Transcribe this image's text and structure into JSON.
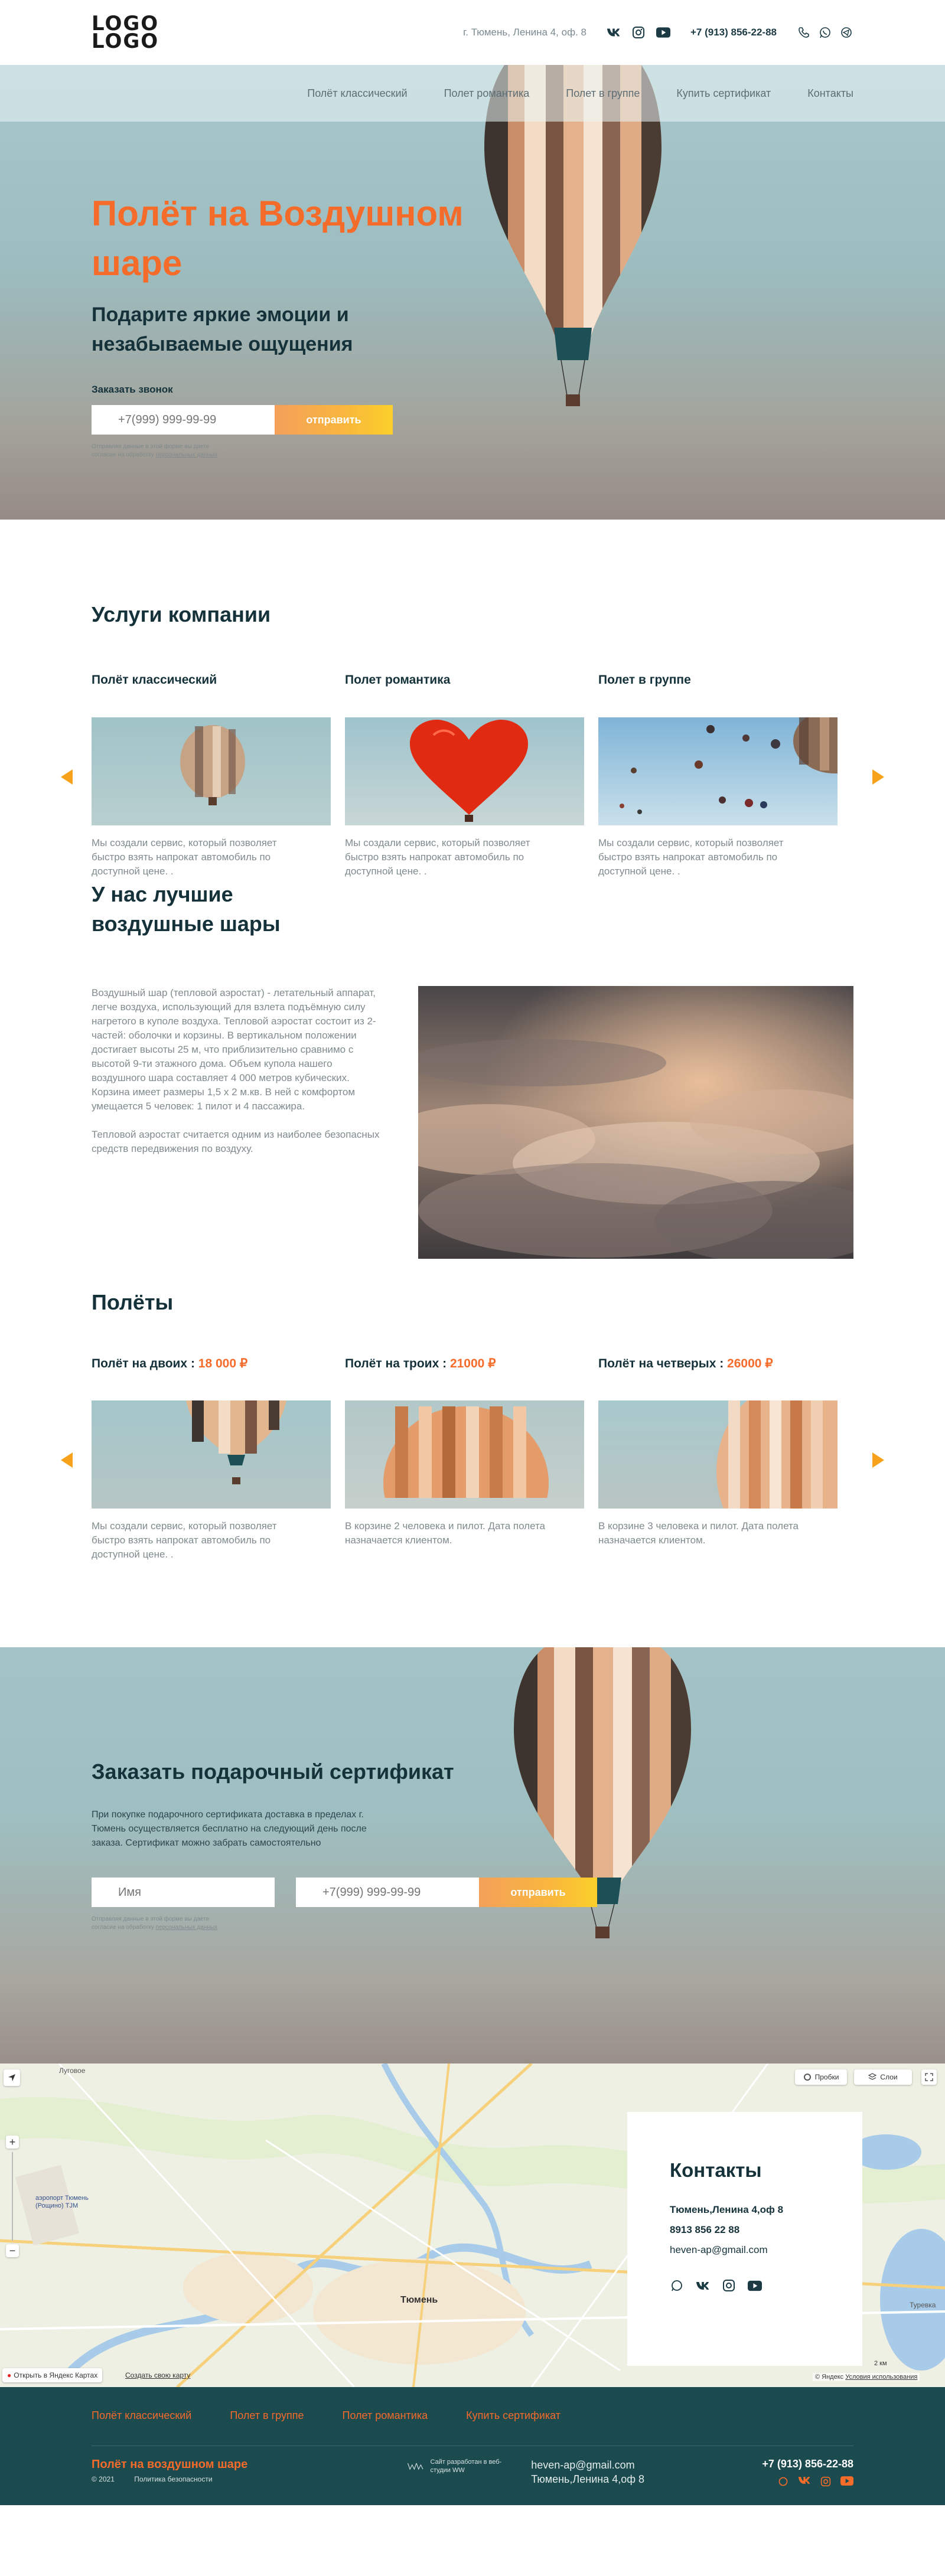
{
  "logo": {
    "line1": "LOGO",
    "line2": "LOGO"
  },
  "header": {
    "address": "г. Тюмень, Ленина 4, оф. 8",
    "phone": "+7 (913) 856-22-88"
  },
  "nav": [
    "Полёт классический",
    "Полет романтика",
    "Полет в группе",
    "Купить сертификат",
    "Контакты"
  ],
  "hero": {
    "title": "Полёт на Воздушном шаре",
    "subtitle": "Подарите яркие эмоции и незабываемые ощущения",
    "form_label": "Заказать звонок",
    "phone_placeholder": "+7(999) 999-99-99",
    "submit": "отправить",
    "hint_text": "Отправляя данные в этой форме вы даете согласие на обработку",
    "hint_link": "персональных данных"
  },
  "services": {
    "title": "Услуги компании",
    "cards": [
      {
        "title": "Полёт классический",
        "text": "Мы создали сервис, который позволяет быстро взять напрокат автомобиль по доступной цене. ."
      },
      {
        "title": "Полет романтика",
        "text": "Мы создали сервис, который позволяет быстро взять напрокат автомобиль по доступной цене. ."
      },
      {
        "title": "Полет в группе",
        "text": "Мы создали сервис, который позволяет быстро взять напрокат автомобиль по доступной цене. ."
      }
    ]
  },
  "about": {
    "title": "У нас лучшие воздушные шары",
    "p1": "Воздушный шар (тепловой аэростат) - летательный аппарат, легче воздуха, использующий для взлета подъёмную силу нагретого в куполе воздуха. Тепловой аэростат состоит из 2- частей: оболочки и корзины. В вертикальном положении достигает высоты 25 м, что приблизительно сравнимо с высотой 9-ти этажного дома. Объем купола нашего воздушного шара составляет 4 000 метров кубических. Корзина имеет размеры 1,5 х 2 м.кв. В ней с комфортом умещается 5 человек: 1 пилот и 4 пассажира.",
    "p2": "Тепловой аэростат считается одним из наиболее безопасных средств передвижения по воздуху."
  },
  "flights": {
    "title": "Полёты",
    "cards": [
      {
        "title": "Полёт на двоих : ",
        "price": "18 000 ₽",
        "text": "Мы создали сервис, который позволяет быстро взять напрокат автомобиль по доступной цене. ."
      },
      {
        "title": "Полёт на троих : ",
        "price": "21000 ₽",
        "text": "В корзине 2 человека и пилот. Дата полета назначается клиентом."
      },
      {
        "title": "Полёт на четверых : ",
        "price": "26000 ₽",
        "text": "В корзине 3 человека и пилот. Дата полета назначается клиентом."
      }
    ]
  },
  "certificate": {
    "title": "Заказать подарочный сертификат",
    "text": "При покупке подарочного сертификата доставка в пределах г. Тюмень осуществляется бесплатно на следующий день после заказа. Сертификат можно забрать самостоятельно",
    "name_placeholder": "Имя",
    "phone_placeholder": "+7(999) 999-99-99",
    "submit": "отправить",
    "hint_text": "Отправляя данные в этой форме вы даете согласие на обработку",
    "hint_link": "персональных данных"
  },
  "map": {
    "city": "Тюмень",
    "town_top": "Луговое",
    "airport": "аэропорт Тюмень (Рощино) TJM",
    "right_town": "Туревка",
    "traffic": "Пробки",
    "layers": "Слои",
    "open_in": "Открыть в Яндекс Картах",
    "create_map": "Создать свою карту",
    "scale": "2 км",
    "copyright": "© Яндекс",
    "terms": "Условия использования",
    "zoom_in": "+",
    "zoom_out": "−"
  },
  "contacts": {
    "title": "Контакты",
    "address": "Тюмень,Ленина 4,оф 8",
    "phone": "8913 856 22 88",
    "email": "heven-ap@gmail.com"
  },
  "footer": {
    "nav": [
      "Полёт классический",
      "Полет в группе",
      "Полет романтика",
      "Купить сертификат"
    ],
    "brand": "Полёт на воздушном шаре",
    "year": "© 2021",
    "policy": "Политика безопасности",
    "dev": "Сайт разработан в веб-студии WW",
    "email": "heven-ap@gmail.com",
    "address": "Тюмень,Ленина 4,оф 8",
    "phone": "+7 (913) 856-22-88"
  },
  "colors": {
    "accent": "#f56b2a",
    "yellow": "#f7a21a",
    "dark": "#15323b",
    "footer": "#1b4a4f"
  }
}
